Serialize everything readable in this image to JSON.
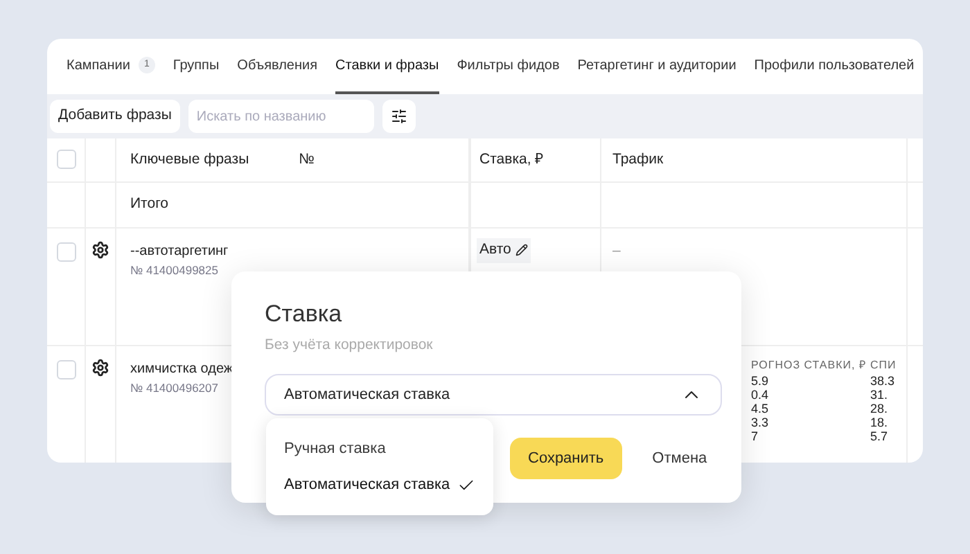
{
  "tabs": [
    {
      "label": "Кампании",
      "badge": "1",
      "selected": false
    },
    {
      "label": "Группы",
      "selected": false
    },
    {
      "label": "Объявления",
      "selected": false
    },
    {
      "label": "Ставки и фразы",
      "selected": true
    },
    {
      "label": "Фильтры фидов",
      "selected": false
    },
    {
      "label": "Ретаргетинг и аудитории",
      "selected": false
    },
    {
      "label": "Профили пользователей",
      "selected": false
    }
  ],
  "toolbar": {
    "add_button": "Добавить фразы",
    "search": {
      "placeholder": "Искать по названию"
    }
  },
  "table": {
    "header_checked": false,
    "columns": [
      "Ключевые фразы",
      "№",
      "Ставка, ₽",
      "Трафик"
    ],
    "summary_row": {
      "label": "Итого"
    },
    "rows": [
      {
        "checked": false,
        "phrase": "--автотаргетинг",
        "number": "№ 41400499825",
        "bid": "Авто",
        "traffic": "–"
      },
      {
        "checked": false,
        "phrase": "химчистка одеж",
        "number": "№ 41400496207",
        "forecast": [
          {
            "header": "РОГНОЗ СТАВКИ, ₽",
            "values": [
              "5.9",
              "0.4",
              "4.5",
              "3.3",
              "7"
            ]
          },
          {
            "header": "СПИ",
            "values": [
              "38.3",
              "31.",
              "28.",
              "18.",
              "5.7"
            ]
          }
        ]
      }
    ]
  },
  "popup": {
    "title": "Ставка",
    "subtitle": "Без учёта корректировок",
    "select": {
      "value": "Автоматическая ставка",
      "expanded": true
    },
    "options": [
      {
        "label": "Ручная ставка",
        "selected": false
      },
      {
        "label": "Автоматическая ставка",
        "selected": true
      }
    ],
    "buttons": [
      {
        "label": "Сохранить",
        "kind": "primary"
      },
      {
        "label": "Отмена",
        "kind": "secondary"
      }
    ]
  }
}
